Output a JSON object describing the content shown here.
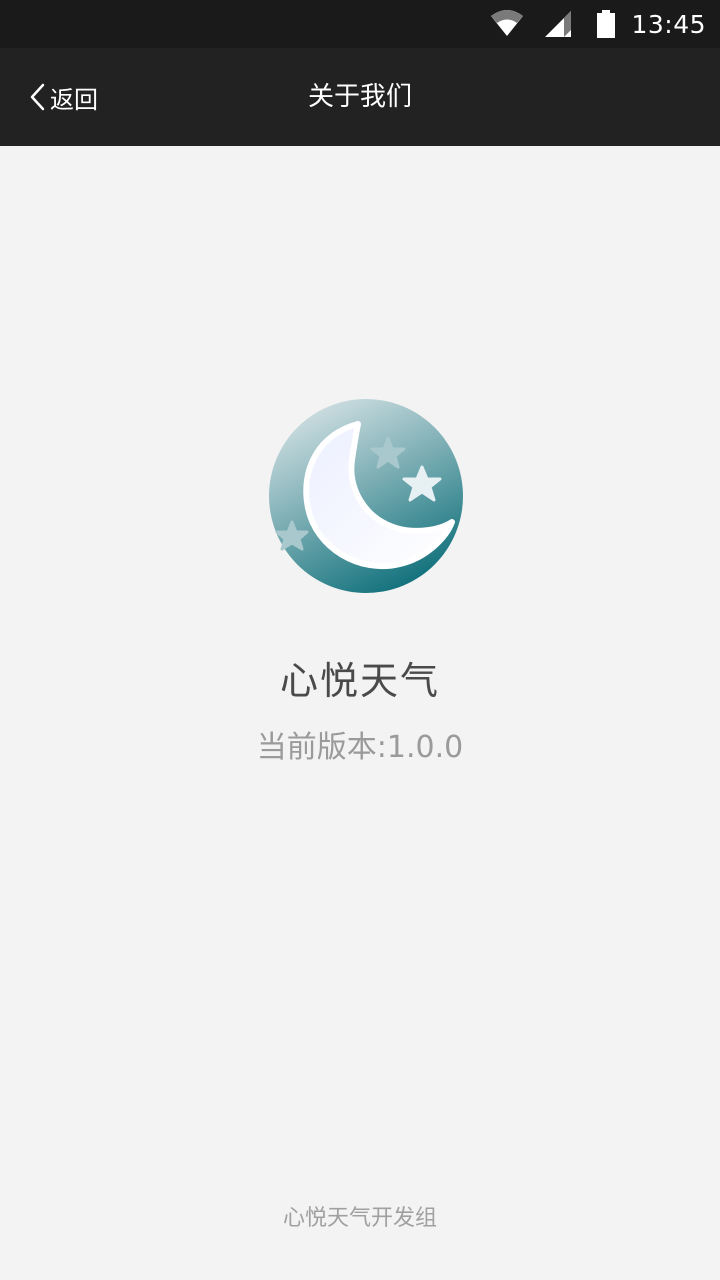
{
  "status_bar": {
    "time": "13:45",
    "icons": [
      "wifi-icon",
      "signal-icon",
      "battery-icon"
    ]
  },
  "header": {
    "back_label": "返回",
    "title": "关于我们",
    "background": "#222222"
  },
  "app": {
    "logo_icon": "moon-stars-icon",
    "name": "心悦天气",
    "version": "当前版本:1.0.0",
    "accent": "#1e7e86"
  },
  "footer": {
    "credit": "心悦天气开发组"
  }
}
